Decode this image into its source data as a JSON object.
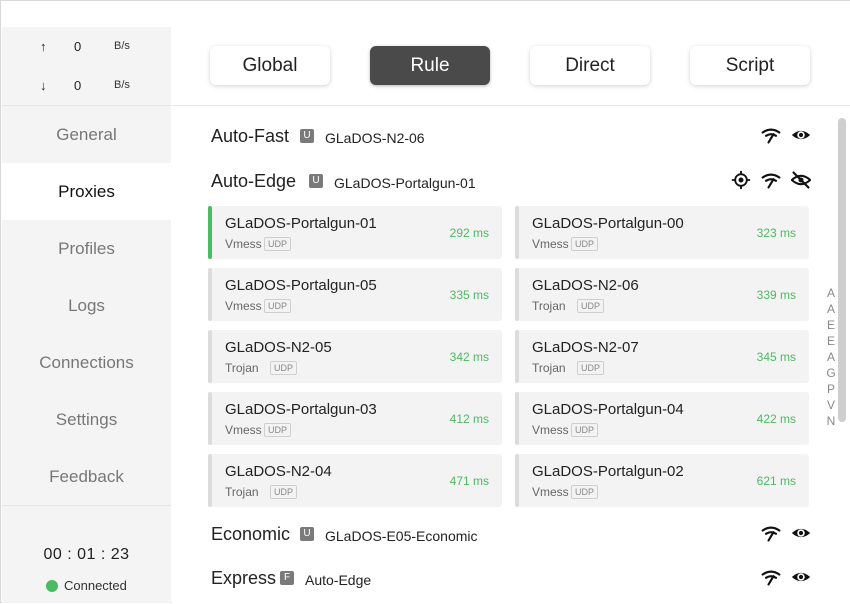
{
  "window_controls": {
    "pin": "pin-icon",
    "minimize": "minimize-icon",
    "maximize": "maximize-icon",
    "close": "close-icon"
  },
  "traffic": {
    "up": {
      "arrow": "↑",
      "value": "0",
      "unit": "B/s"
    },
    "down": {
      "arrow": "↓",
      "value": "0",
      "unit": "B/s"
    }
  },
  "nav": [
    "General",
    "Proxies",
    "Profiles",
    "Logs",
    "Connections",
    "Settings",
    "Feedback"
  ],
  "nav_active": "Proxies",
  "status": {
    "uptime": "00 : 01 : 23",
    "connection": "Connected"
  },
  "modes": [
    "Global",
    "Rule",
    "Direct",
    "Script"
  ],
  "active_mode": "Rule",
  "groups": [
    {
      "name": "Auto-Fast",
      "badge": "U",
      "current": "GLaDOS-N2-06",
      "icons": [
        "wifi-icon",
        "eye-icon"
      ]
    },
    {
      "name": "Auto-Edge",
      "badge": "U",
      "current": "GLaDOS-Portalgun-01",
      "icons": [
        "locate-icon",
        "wifi-icon",
        "eye-off-icon"
      ]
    },
    {
      "name": "Economic",
      "badge": "U",
      "current": "GLaDOS-E05-Economic",
      "icons": [
        "wifi-icon",
        "eye-icon"
      ]
    },
    {
      "name": "Express",
      "badge": "F",
      "current": "Auto-Edge",
      "icons": [
        "wifi-icon",
        "eye-icon"
      ]
    }
  ],
  "proxies": [
    {
      "name": "GLaDOS-Portalgun-01",
      "type": "Vmess",
      "udp": "UDP",
      "delay": "292 ms",
      "selected": true
    },
    {
      "name": "GLaDOS-Portalgun-00",
      "type": "Vmess",
      "udp": "UDP",
      "delay": "323 ms",
      "selected": false
    },
    {
      "name": "GLaDOS-Portalgun-05",
      "type": "Vmess",
      "udp": "UDP",
      "delay": "335 ms",
      "selected": false
    },
    {
      "name": "GLaDOS-N2-06",
      "type": "Trojan",
      "udp": "UDP",
      "delay": "339 ms",
      "selected": false
    },
    {
      "name": "GLaDOS-N2-05",
      "type": "Trojan",
      "udp": "UDP",
      "delay": "342 ms",
      "selected": false
    },
    {
      "name": "GLaDOS-N2-07",
      "type": "Trojan",
      "udp": "UDP",
      "delay": "345 ms",
      "selected": false
    },
    {
      "name": "GLaDOS-Portalgun-03",
      "type": "Vmess",
      "udp": "UDP",
      "delay": "412 ms",
      "selected": false
    },
    {
      "name": "GLaDOS-Portalgun-04",
      "type": "Vmess",
      "udp": "UDP",
      "delay": "422 ms",
      "selected": false
    },
    {
      "name": "GLaDOS-N2-04",
      "type": "Trojan",
      "udp": "UDP",
      "delay": "471 ms",
      "selected": false
    },
    {
      "name": "GLaDOS-Portalgun-02",
      "type": "Vmess",
      "udp": "UDP",
      "delay": "621 ms",
      "selected": false
    }
  ],
  "alpha_index": [
    "A",
    "A",
    "E",
    "E",
    "A",
    "G",
    "P",
    "V",
    "N"
  ],
  "colors": {
    "accent": "#4cb963",
    "active_mode_bg": "#4a4a4a",
    "sidebar_bg": "#f4f4f4",
    "badge_bg": "#7a7a7a"
  }
}
